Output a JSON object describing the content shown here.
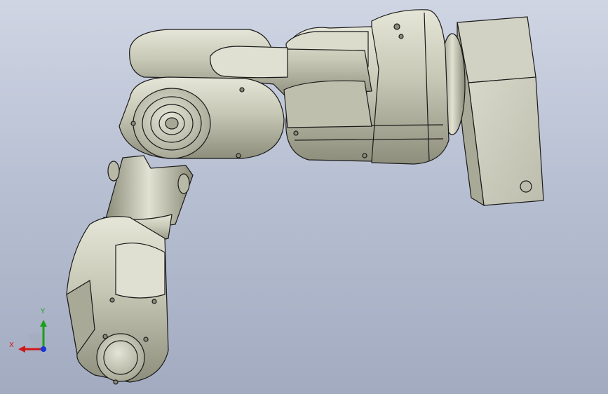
{
  "viewport": {
    "background_top": "#cfd5e3",
    "background_bottom": "#a3abc1"
  },
  "model": {
    "name": "robot-arm-assembly",
    "body_color": "#c9c9b9",
    "shadow_color": "#7d7d6c",
    "edge_color": "#1a1a1a"
  },
  "triad": {
    "y_label": "Y",
    "x_label": "X",
    "colors": {
      "x": "#d01818",
      "y": "#1aa01a",
      "z": "#1535d8"
    }
  }
}
